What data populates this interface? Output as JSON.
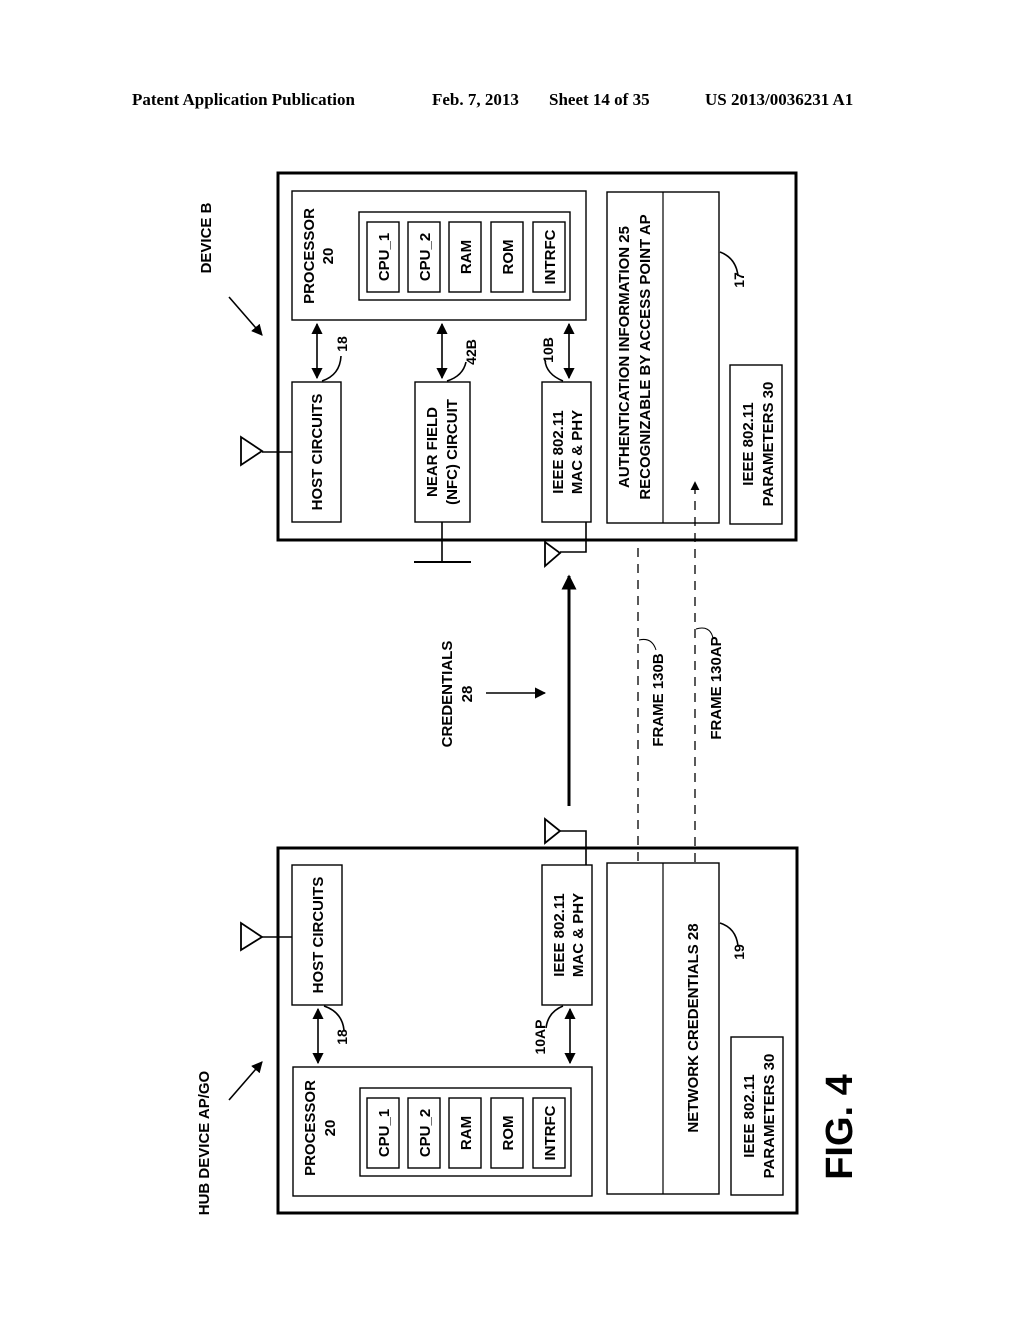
{
  "header": {
    "publication": "Patent Application Publication",
    "date": "Feb. 7, 2013",
    "sheet": "Sheet 14 of 35",
    "number": "US 2013/0036231 A1"
  },
  "figure_label": "FIG. 4",
  "device_b": {
    "label": "DEVICE B",
    "processor": {
      "title": "PROCESSOR",
      "ref": "20",
      "chips": [
        "CPU_1",
        "CPU_2",
        "RAM",
        "ROM",
        "INTRFC"
      ]
    },
    "host_circuits": "HOST CIRCUITS",
    "host_ref": "18",
    "nfc": {
      "line1": "NEAR FIELD",
      "line2": "(NFC) CIRCUIT",
      "ref": "42B"
    },
    "mac": {
      "line1": "IEEE 802.11",
      "line2": "MAC & PHY",
      "ref": "10B"
    },
    "memory": {
      "line1": "AUTHENTICATION INFORMATION  25",
      "line2": "RECOGNIZABLE BY ACCESS POINT AP",
      "ref": "17"
    },
    "params": {
      "line1": "IEEE 802.11",
      "line2": "PARAMETERS 30"
    }
  },
  "hub_device": {
    "label": "HUB DEVICE AP/GO",
    "processor": {
      "title": "PROCESSOR",
      "ref": "20",
      "chips": [
        "CPU_1",
        "CPU_2",
        "RAM",
        "ROM",
        "INTRFC"
      ]
    },
    "host_circuits": "HOST CIRCUITS",
    "host_ref": "18",
    "mac": {
      "line1": "IEEE 802.11",
      "line2": "MAC & PHY",
      "ref": "10AP"
    },
    "memory": {
      "line1": "NETWORK CREDENTIALS 28",
      "ref": "19"
    },
    "params": {
      "line1": "IEEE 802.11",
      "line2": "PARAMETERS 30"
    }
  },
  "links": {
    "credentials": {
      "line1": "CREDENTIALS",
      "line2": "28"
    },
    "frame_b": "FRAME 130B",
    "frame_ap": "FRAME 130AP"
  }
}
